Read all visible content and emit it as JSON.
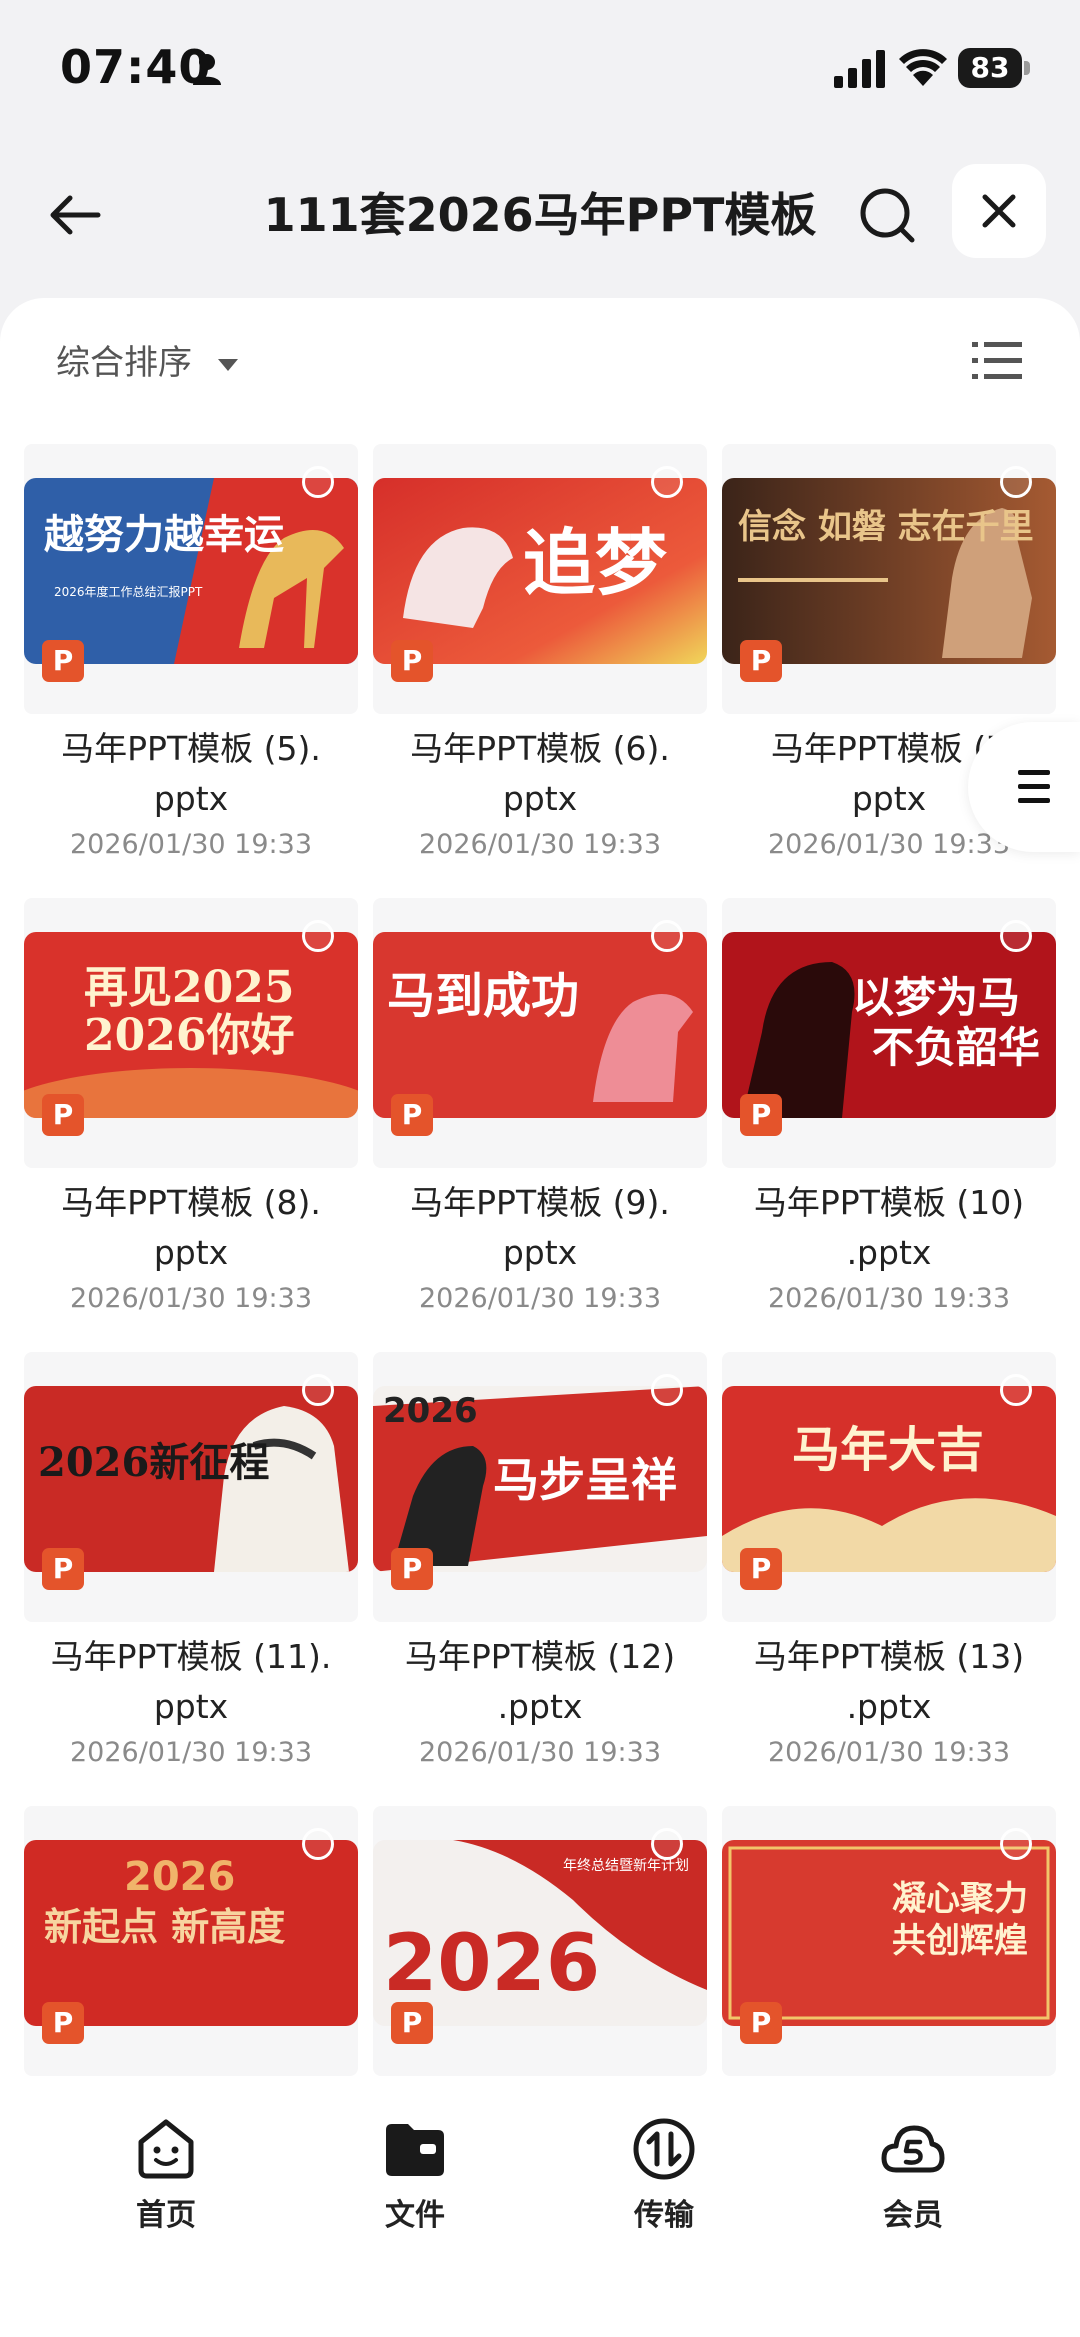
{
  "status_bar": {
    "time": "07:40",
    "battery": "83"
  },
  "header": {
    "title": "111套2026马年PPT模板"
  },
  "toolbar": {
    "sort_label": "综合排序"
  },
  "file_badge": "P",
  "files": [
    {
      "name_line1": "马年PPT模板 (5).",
      "name_line2": "pptx",
      "date": "2026/01/30 19:33",
      "thumb_text": "越努力越幸运",
      "thumb_sub": "2026年度工作总结汇报PPT"
    },
    {
      "name_line1": "马年PPT模板 (6).",
      "name_line2": "pptx",
      "date": "2026/01/30 19:33",
      "thumb_text": "追梦"
    },
    {
      "name_line1": "马年PPT模板 (7",
      "name_line2": "pptx",
      "date": "2026/01/30 19:33",
      "thumb_text": "信念 如磐 志在千里"
    },
    {
      "name_line1": "马年PPT模板 (8).",
      "name_line2": "pptx",
      "date": "2026/01/30 19:33",
      "thumb_text": "再见2025",
      "thumb_sub": "2026你好"
    },
    {
      "name_line1": "马年PPT模板 (9).",
      "name_line2": "pptx",
      "date": "2026/01/30 19:33",
      "thumb_text": "马到成功"
    },
    {
      "name_line1": "马年PPT模板 (10)",
      "name_line2": ".pptx",
      "date": "2026/01/30 19:33",
      "thumb_text": "以梦为马",
      "thumb_sub": "不负韶华"
    },
    {
      "name_line1": "马年PPT模板 (11).",
      "name_line2": "pptx",
      "date": "2026/01/30 19:33",
      "thumb_text": "2026新征程"
    },
    {
      "name_line1": "马年PPT模板 (12)",
      "name_line2": ".pptx",
      "date": "2026/01/30 19:33",
      "thumb_text": "马步呈祥",
      "thumb_sub": "2026"
    },
    {
      "name_line1": "马年PPT模板 (13)",
      "name_line2": ".pptx",
      "date": "2026/01/30 19:33",
      "thumb_text": "马年大吉"
    },
    {
      "thumb_text": "新起点 新高度",
      "thumb_sub": "2026"
    },
    {
      "thumb_text": "2026",
      "thumb_sub": "年终总结暨新年计划"
    },
    {
      "thumb_text": "凝心聚力",
      "thumb_sub": "共创辉煌"
    }
  ],
  "bottom_nav": [
    {
      "label": "首页",
      "icon": "home-face-icon"
    },
    {
      "label": "文件",
      "icon": "folder-icon"
    },
    {
      "label": "传输",
      "icon": "transfer-icon"
    },
    {
      "label": "会员",
      "icon": "vip-cloud-icon"
    }
  ],
  "colors": {
    "accent_red": "#d9322b",
    "badge_orange": "#e4542b"
  }
}
